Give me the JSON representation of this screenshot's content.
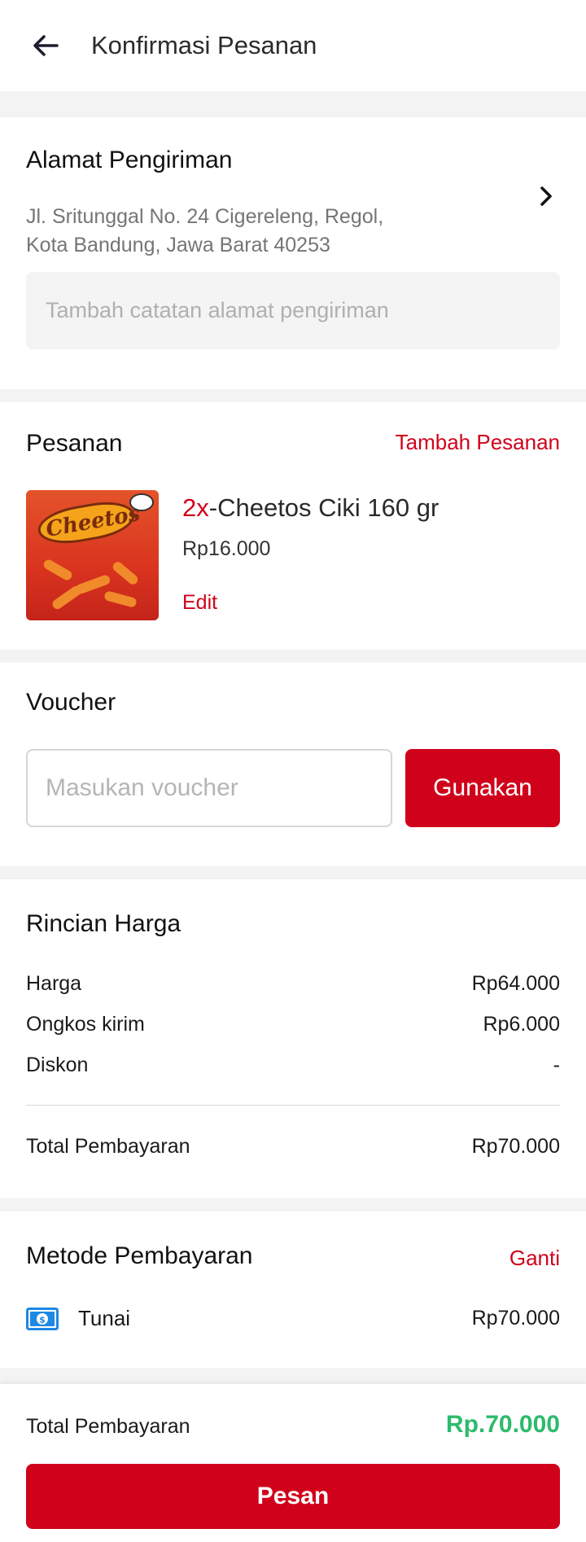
{
  "header": {
    "title": "Konfirmasi Pesanan",
    "back_icon": "arrow-left-icon"
  },
  "address": {
    "title": "Alamat Pengiriman",
    "line1": "Jl. Sritunggal No. 24 Cigereleng, Regol,",
    "line2": "Kota Bandung, Jawa Barat 40253",
    "note_placeholder": "Tambah catatan alamat pengiriman",
    "chevron_icon": "chevron-right-icon"
  },
  "order": {
    "title": "Pesanan",
    "add_link": "Tambah Pesanan",
    "item": {
      "qty": "2x",
      "separator": "-",
      "name": "Cheetos Ciki 160 gr",
      "price": "Rp16.000",
      "edit_label": "Edit",
      "image_label": "Cheetos"
    }
  },
  "voucher": {
    "title": "Voucher",
    "placeholder": "Masukan voucher",
    "button_label": "Gunakan"
  },
  "price_details": {
    "title": "Rincian Harga",
    "rows": [
      {
        "label": "Harga",
        "value": "Rp64.000"
      },
      {
        "label": "Ongkos kirim",
        "value": "Rp6.000"
      },
      {
        "label": "Diskon",
        "value": "-"
      }
    ],
    "total_label": "Total Pembayaran",
    "total_value": "Rp70.000"
  },
  "payment": {
    "title": "Metode Pembayaran",
    "change_link": "Ganti",
    "method_icon": "cash-icon",
    "method_name": "Tunai",
    "method_amount": "Rp70.000"
  },
  "footer": {
    "total_label": "Total Pembayaran",
    "total_value": "Rp.70.000",
    "order_button": "Pesan"
  },
  "colors": {
    "primary_red": "#d0021b",
    "total_green": "#2dbb6b",
    "background": "#f3f3f3",
    "cash_blue": "#1e88e5"
  }
}
